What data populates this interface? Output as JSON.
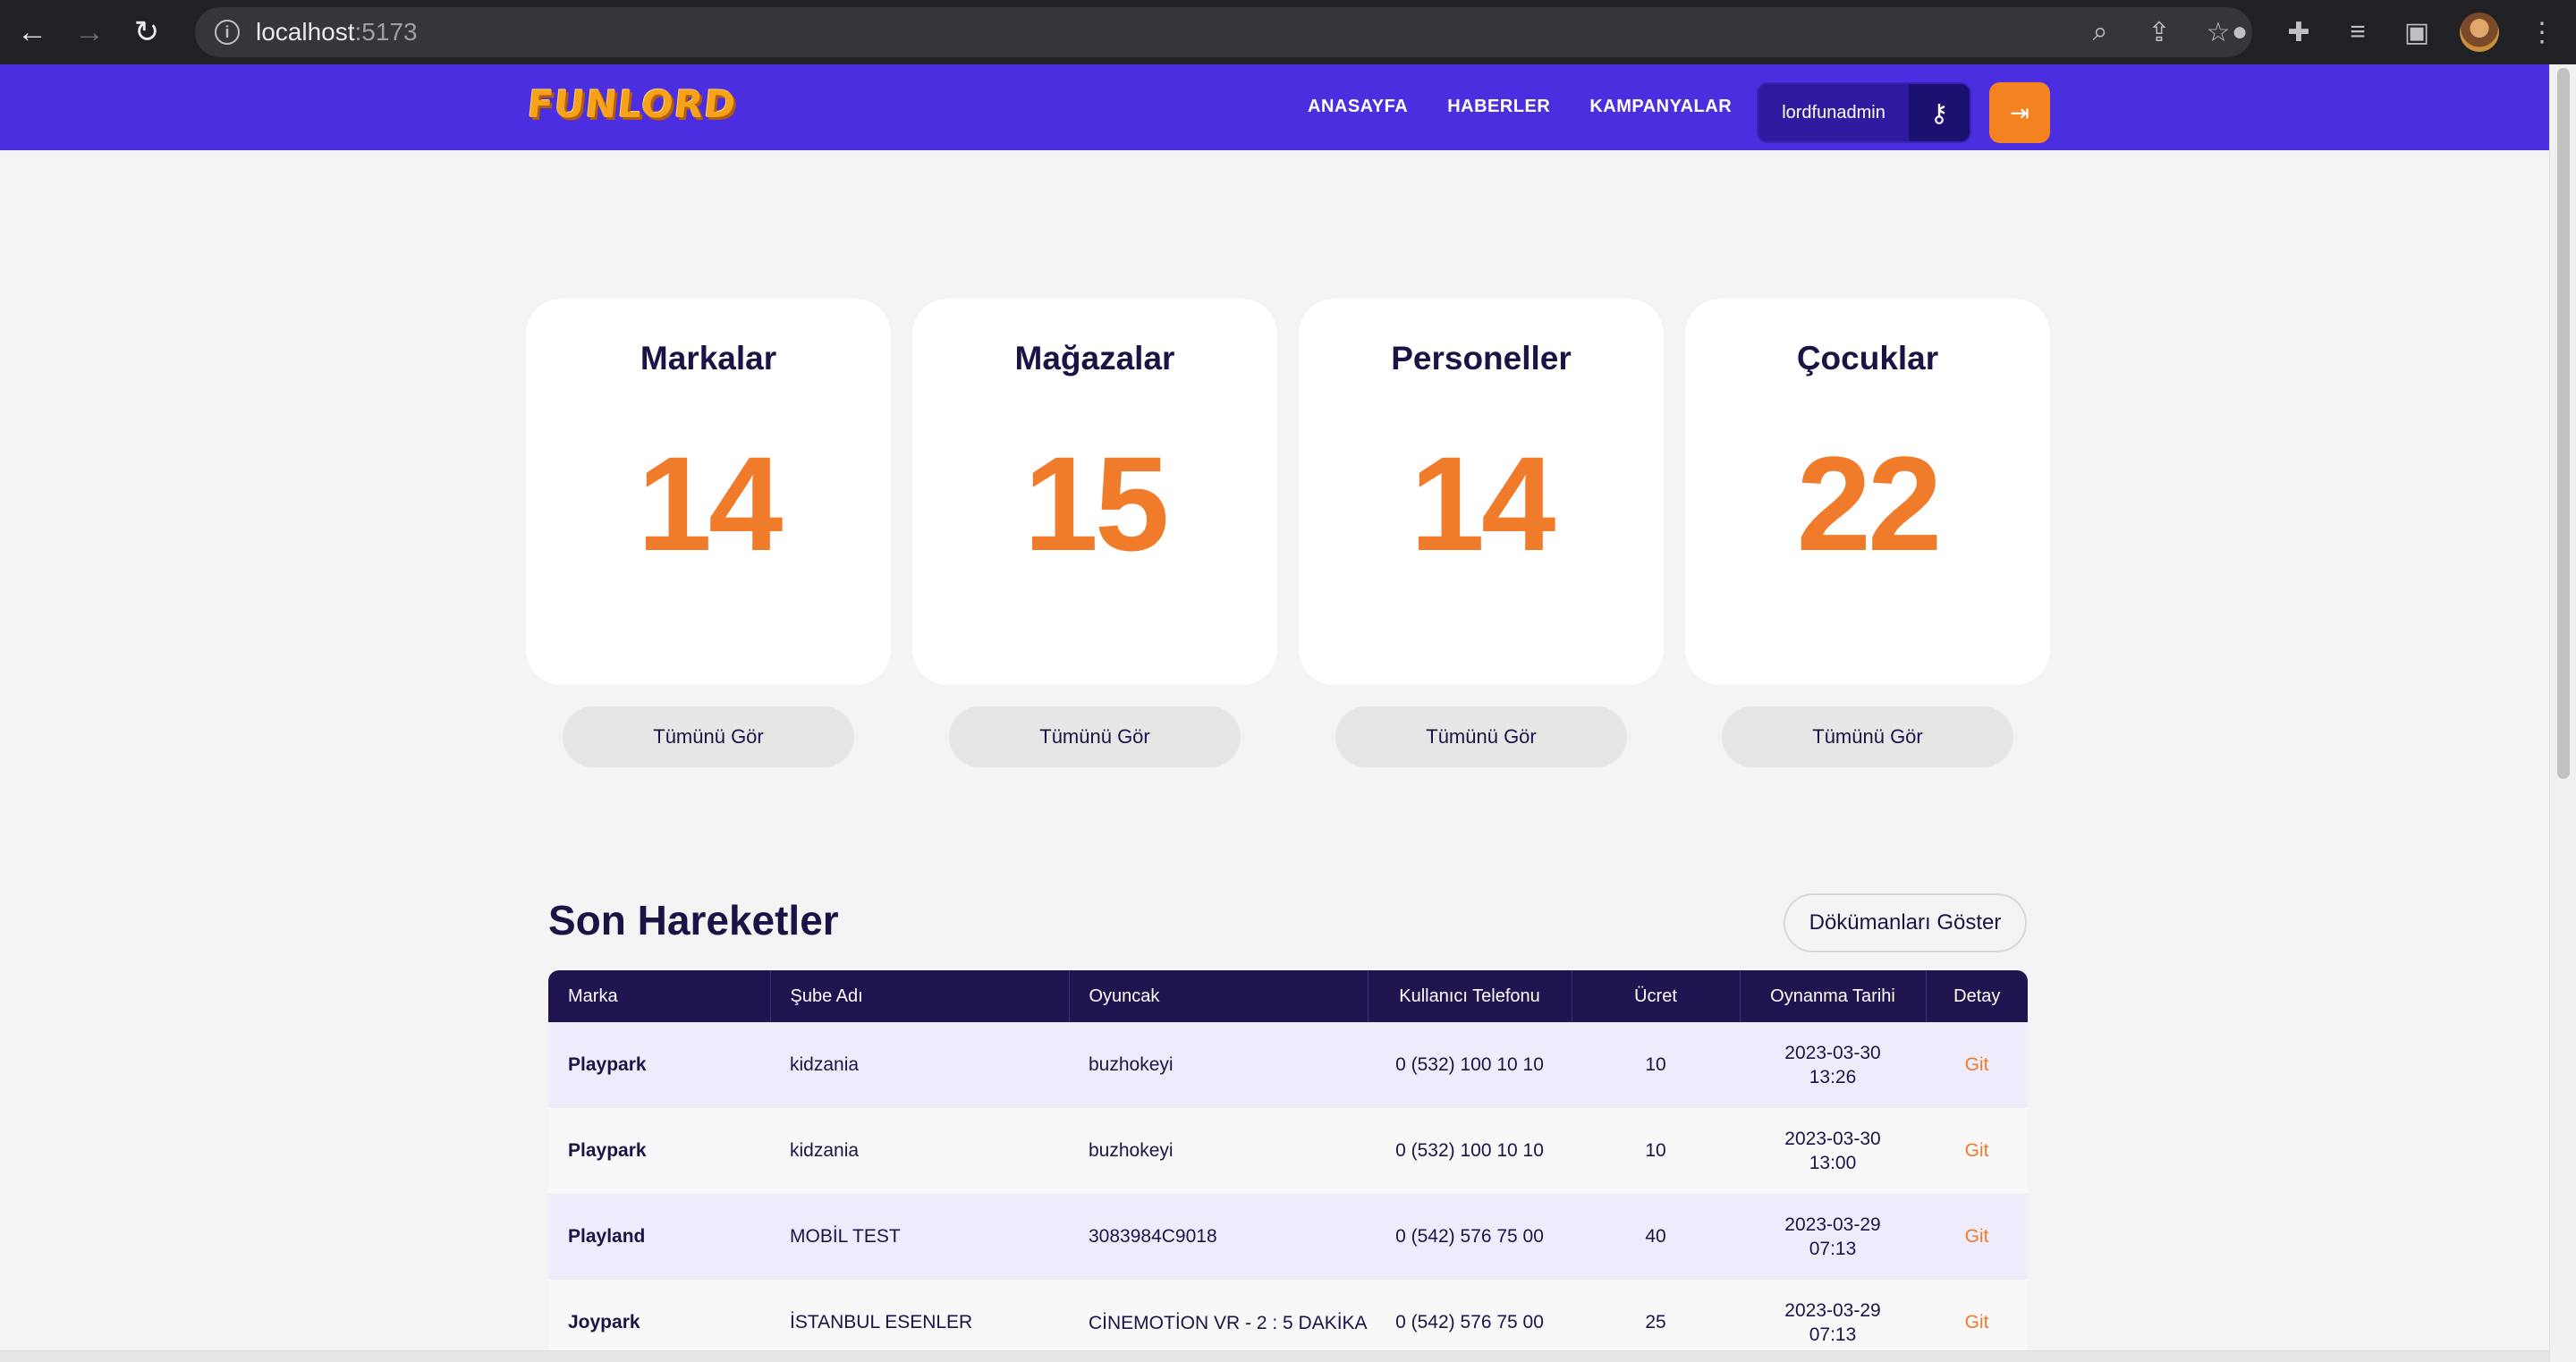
{
  "browser": {
    "url_host": "localhost",
    "url_port": ":5173"
  },
  "header": {
    "logo_text": "FUNLORD",
    "nav": [
      "ANASAYFA",
      "HABERLER",
      "KAMPANYALAR"
    ],
    "username": "lordfunadmin"
  },
  "stats": [
    {
      "title": "Markalar",
      "value": "14",
      "button": "Tümünü Gör"
    },
    {
      "title": "Mağazalar",
      "value": "15",
      "button": "Tümünü Gör"
    },
    {
      "title": "Personeller",
      "value": "14",
      "button": "Tümünü Gör"
    },
    {
      "title": "Çocuklar",
      "value": "22",
      "button": "Tümünü Gör"
    }
  ],
  "recent": {
    "title": "Son Hareketler",
    "docs_button": "Dökümanları Göster",
    "columns": [
      "Marka",
      "Şube Adı",
      "Oyuncak",
      "Kullanıcı Telefonu",
      "Ücret",
      "Oynanma Tarihi",
      "Detay"
    ],
    "rows": [
      {
        "brand": "Playpark",
        "branch": "kidzania",
        "toy": "buzhokeyi",
        "phone": "0 (532) 100 10 10",
        "fee": "10",
        "date": "2023-03-30",
        "time": "13:26",
        "detail": "Git"
      },
      {
        "brand": "Playpark",
        "branch": "kidzania",
        "toy": "buzhokeyi",
        "phone": "0 (532) 100 10 10",
        "fee": "10",
        "date": "2023-03-30",
        "time": "13:00",
        "detail": "Git"
      },
      {
        "brand": "Playland",
        "branch": "MOBİL TEST",
        "toy": "3083984C9018",
        "phone": "0 (542) 576 75 00",
        "fee": "40",
        "date": "2023-03-29",
        "time": "07:13",
        "detail": "Git"
      },
      {
        "brand": "Joypark",
        "branch": "İSTANBUL ESENLER",
        "toy": "CİNEMOTİON VR - 2 : 5 DAKİKA",
        "phone": "0 (542) 576 75 00",
        "fee": "25",
        "date": "2023-03-29",
        "time": "07:13",
        "detail": "Git"
      }
    ]
  },
  "colors": {
    "header_bg": "#4b2ee0",
    "accent": "#f07b2a",
    "table_header": "#1f144f"
  }
}
